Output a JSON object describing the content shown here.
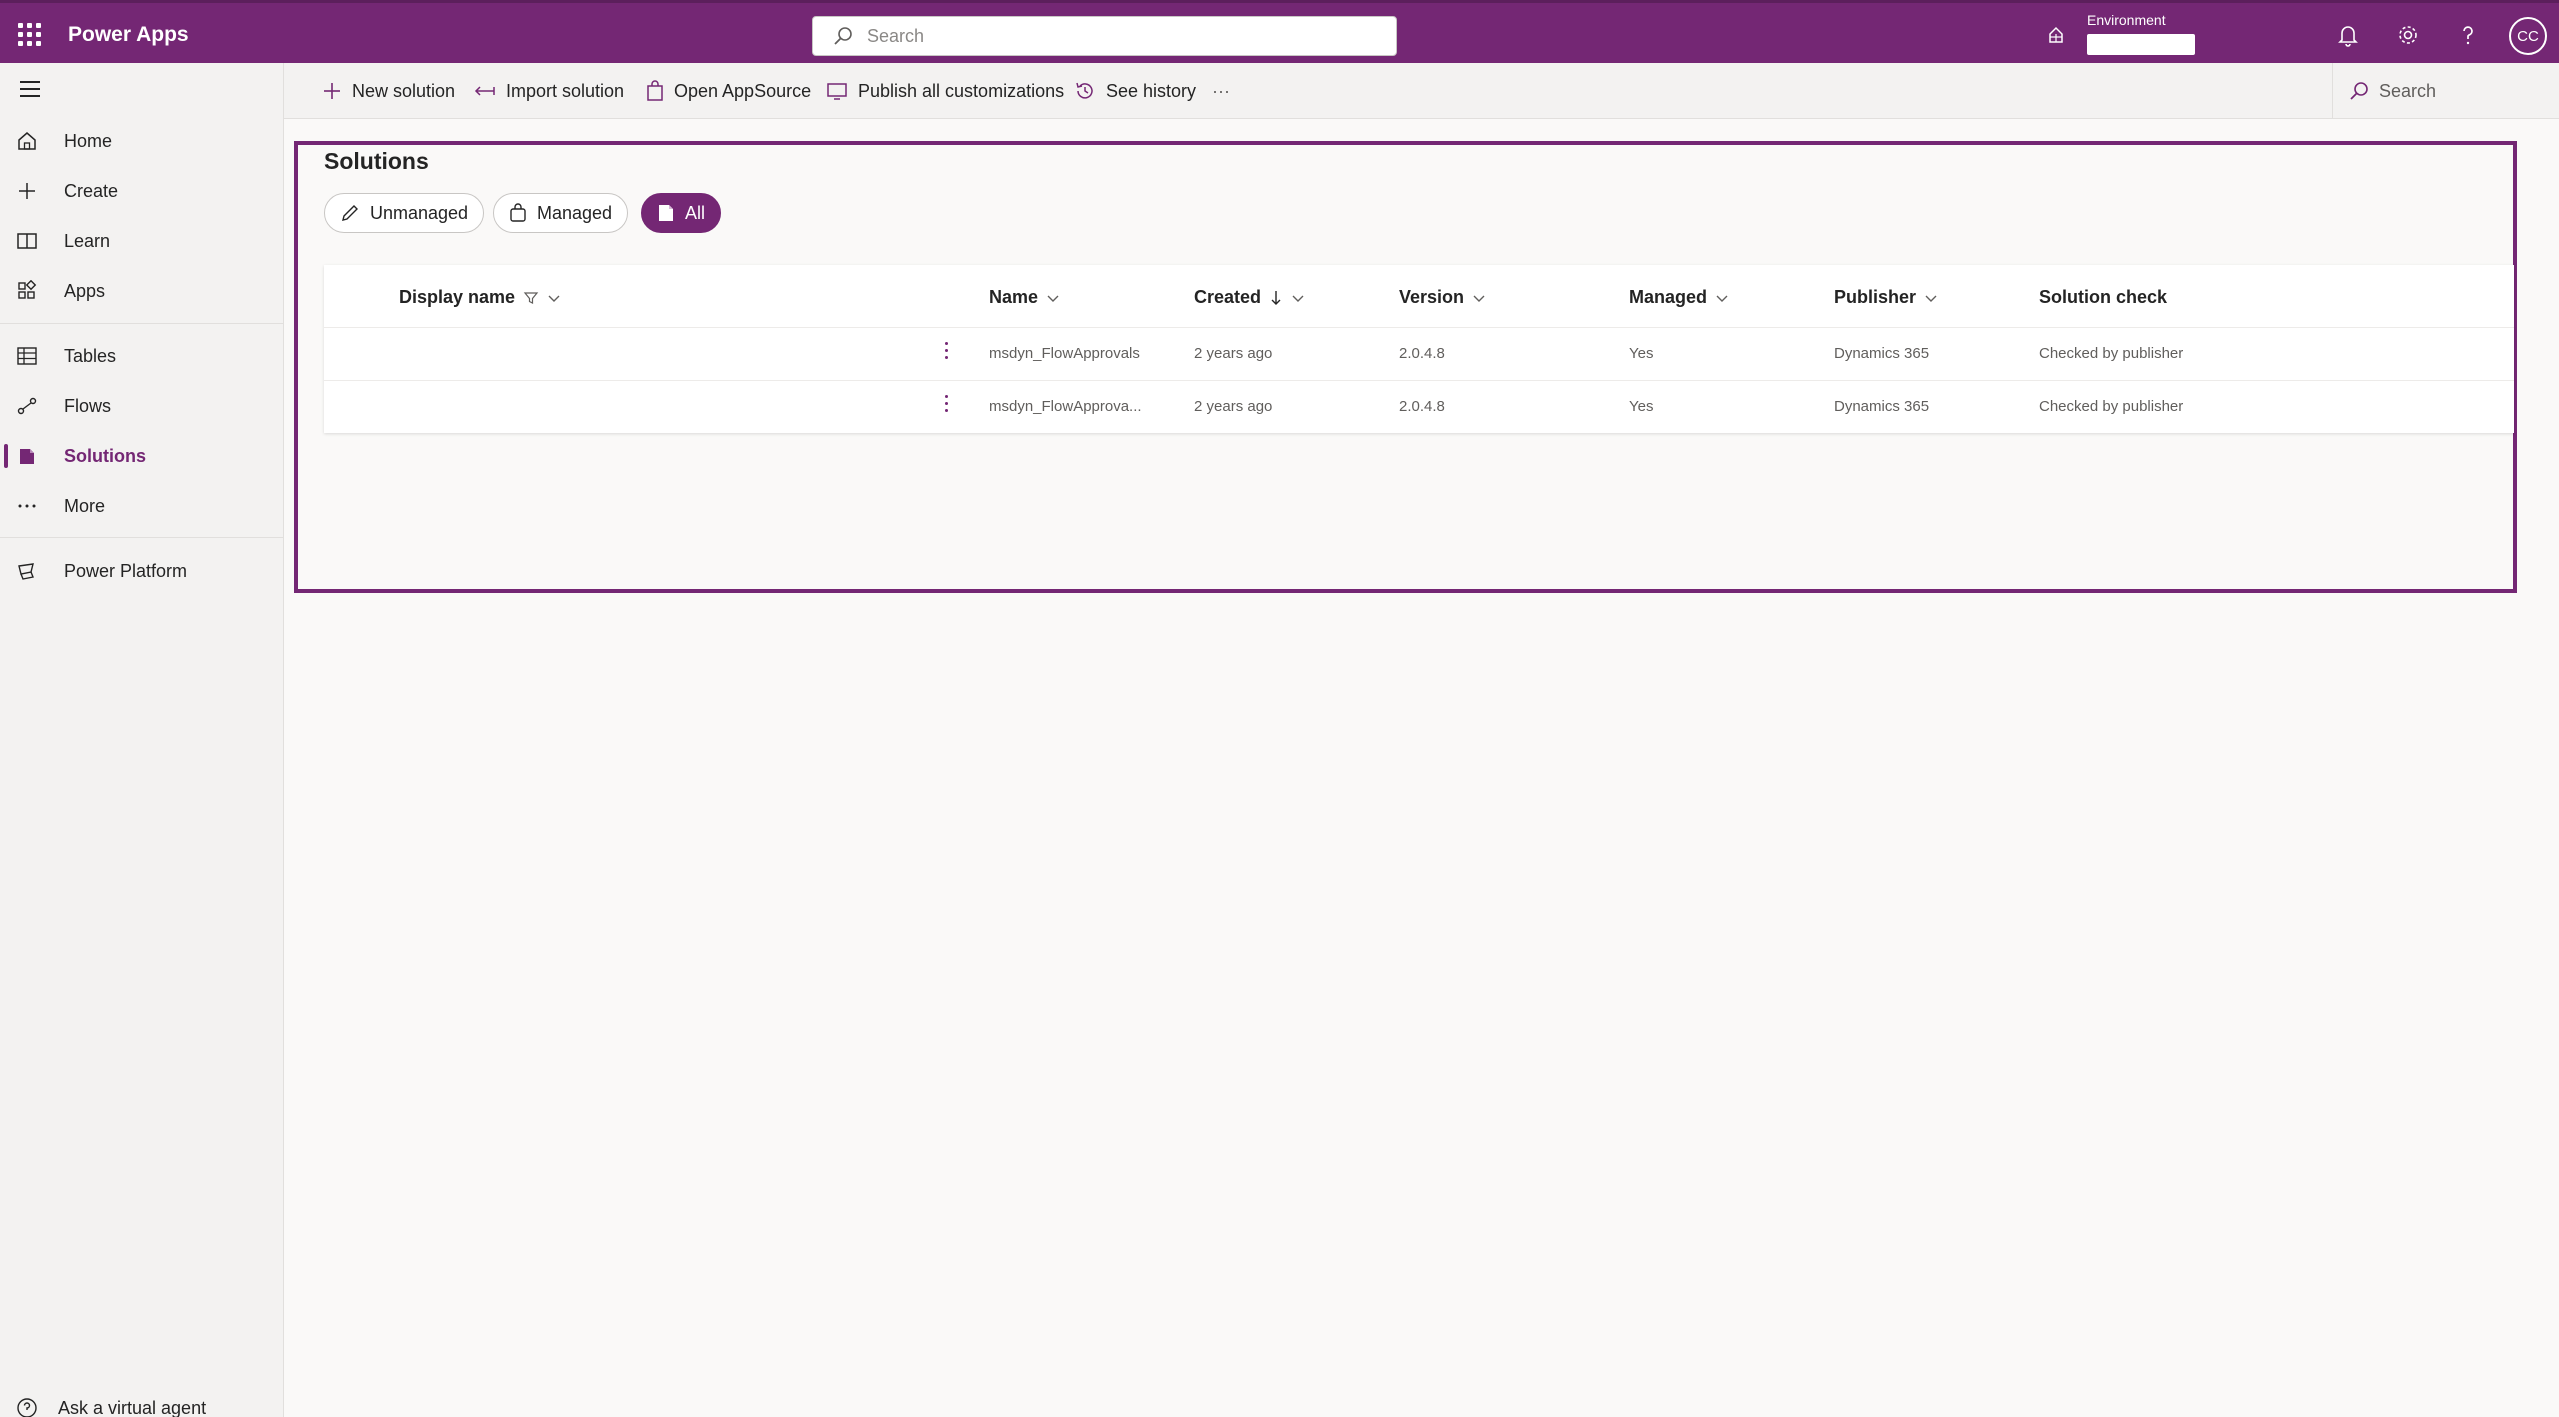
{
  "app": {
    "title": "Power Apps"
  },
  "topbar": {
    "search_placeholder": "Search",
    "environment_label": "Environment",
    "avatar_initials": "CC"
  },
  "sidebar": {
    "items": [
      {
        "label": "Home",
        "icon": "home-icon"
      },
      {
        "label": "Create",
        "icon": "plus-icon"
      },
      {
        "label": "Learn",
        "icon": "book-icon"
      },
      {
        "label": "Apps",
        "icon": "apps-icon"
      },
      {
        "label": "Tables",
        "icon": "table-icon"
      },
      {
        "label": "Flows",
        "icon": "flow-icon"
      },
      {
        "label": "Solutions",
        "icon": "solutions-icon",
        "active": true
      },
      {
        "label": "More",
        "icon": "more-icon"
      },
      {
        "label": "Power Platform",
        "icon": "power-platform-icon"
      }
    ],
    "footer": "Ask a virtual agent"
  },
  "commandbar": {
    "new_solution": "New solution",
    "import_solution": "Import solution",
    "open_appsource": "Open AppSource",
    "publish_all": "Publish all customizations",
    "see_history": "See history",
    "more": "···",
    "search_placeholder": "Search"
  },
  "page": {
    "title": "Solutions",
    "filters": [
      {
        "label": "Unmanaged",
        "icon": "pencil-icon"
      },
      {
        "label": "Managed",
        "icon": "bag-icon"
      },
      {
        "label": "All",
        "icon": "solutions-icon",
        "active": true
      }
    ]
  },
  "table": {
    "columns": [
      "Display name",
      "Name",
      "Created",
      "Version",
      "Managed",
      "Publisher",
      "Solution check"
    ],
    "rows": [
      {
        "display_name": "",
        "name": "msdyn_FlowApprovals",
        "created": "2 years ago",
        "version": "2.0.4.8",
        "managed": "Yes",
        "publisher": "Dynamics 365",
        "solution_check": "Checked by publisher"
      },
      {
        "display_name": "",
        "name": "msdyn_FlowApprova...",
        "created": "2 years ago",
        "version": "2.0.4.8",
        "managed": "Yes",
        "publisher": "Dynamics 365",
        "solution_check": "Checked by publisher"
      }
    ]
  },
  "colors": {
    "brand": "#742774",
    "background": "#faf9f8",
    "sidebar": "#f3f2f1"
  }
}
